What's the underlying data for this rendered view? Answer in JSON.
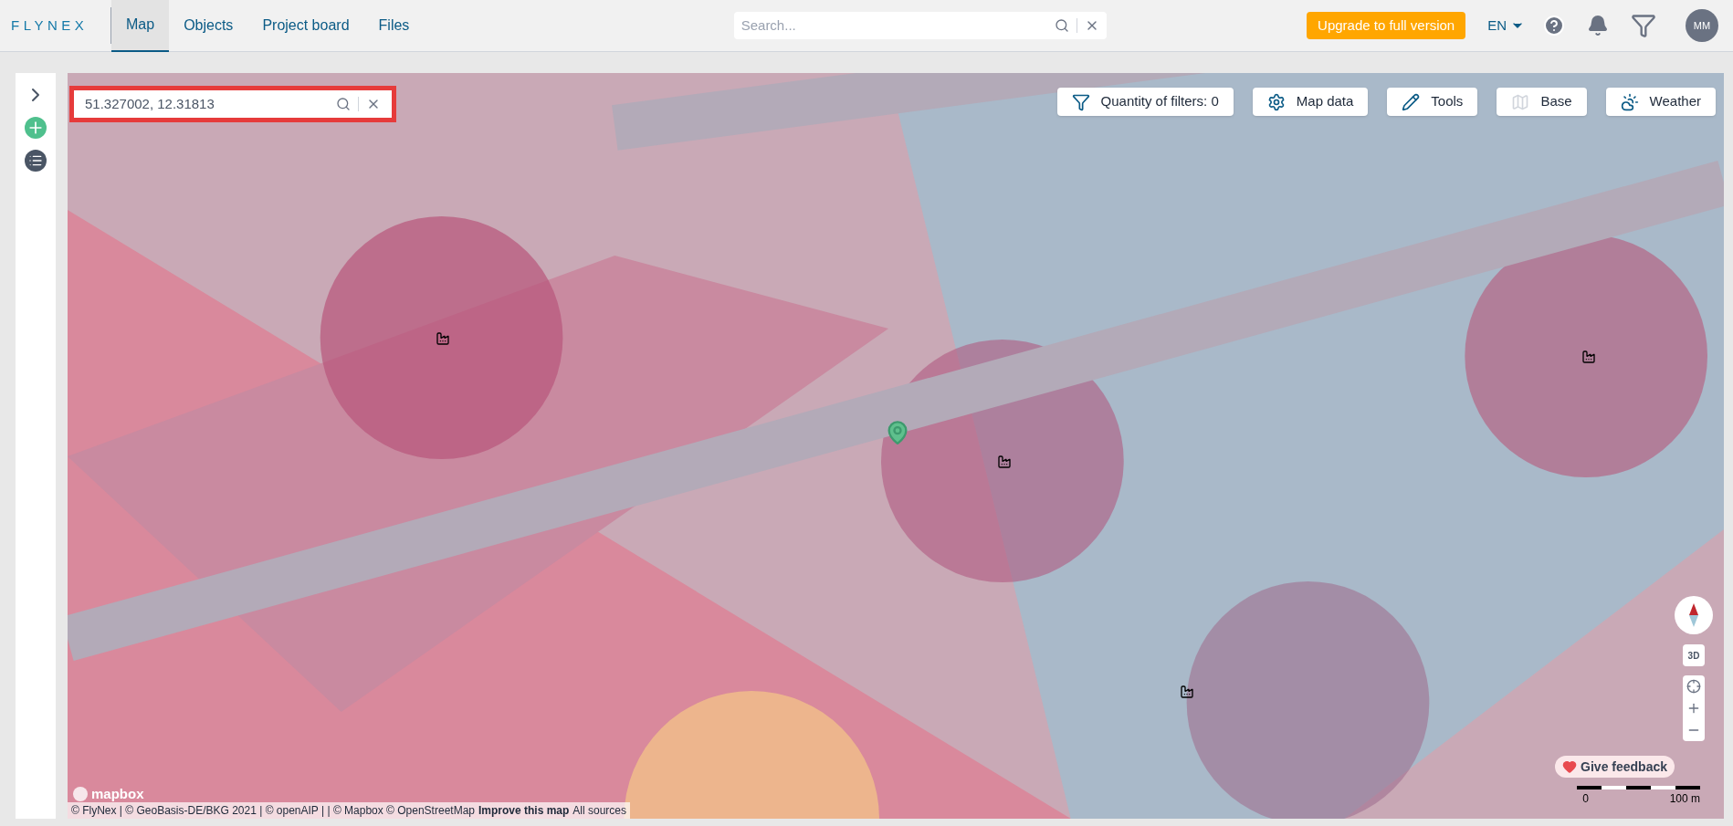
{
  "header": {
    "logo": "FLYNEX",
    "nav": [
      {
        "label": "Map",
        "selected": true
      },
      {
        "label": "Objects",
        "selected": false
      },
      {
        "label": "Project board",
        "selected": false
      },
      {
        "label": "Files",
        "selected": false
      }
    ],
    "search": {
      "placeholder": "Search..."
    },
    "upgrade_button": "Upgrade to full version",
    "language": "EN",
    "avatar": "MM"
  },
  "map": {
    "coordinate_search": {
      "value": "51.327002, 12.31813",
      "highlighted": true
    },
    "toolbar": [
      {
        "kind": "filter",
        "label": "Quantity of filters: 0"
      },
      {
        "kind": "data",
        "label": "Map data"
      },
      {
        "kind": "tools",
        "label": "Tools"
      },
      {
        "kind": "base",
        "label": "Base"
      },
      {
        "kind": "weather",
        "label": "Weather"
      }
    ],
    "mapbox_logo": "mapbox",
    "attribution": "© FlyNex | © GeoBasis-DE/BKG 2021 | © openAIP | | © Mapbox © OpenStreetMap",
    "improve_link": "Improve this map",
    "sources_link": "All sources",
    "feedback_button": "Give feedback",
    "view_3d": "3D",
    "scale": {
      "start": "0",
      "end": "100 m"
    }
  }
}
